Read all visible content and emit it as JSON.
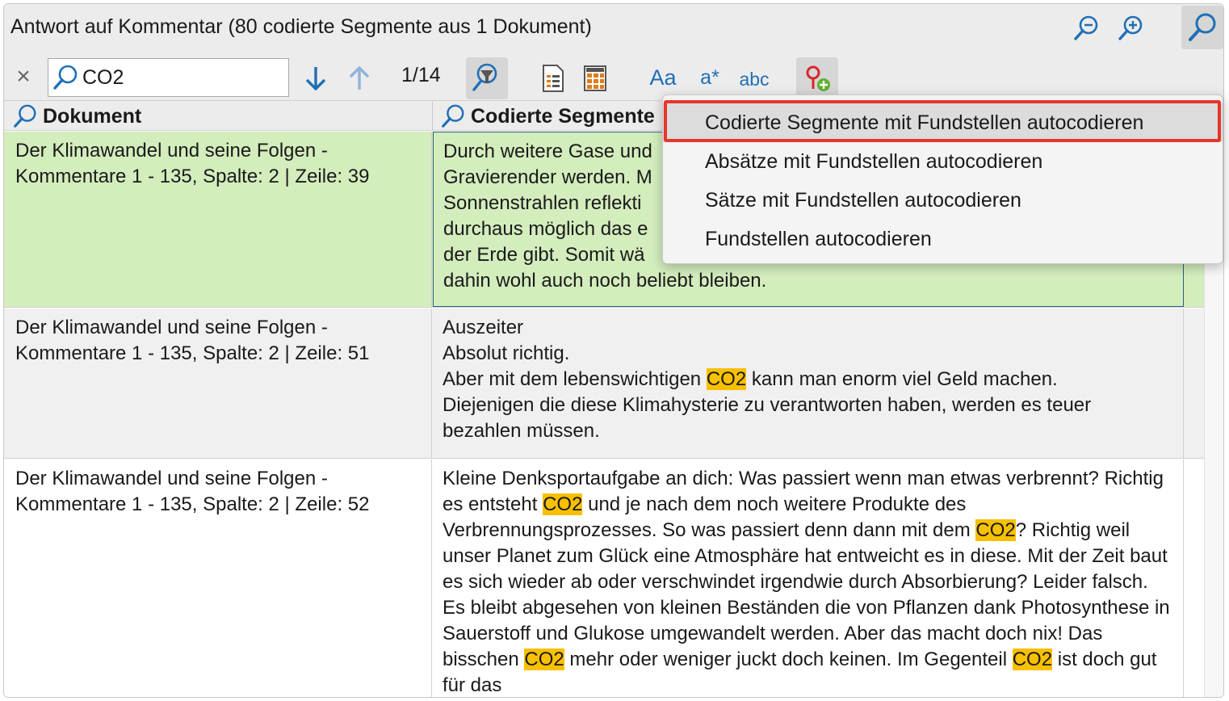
{
  "window": {
    "title": "Antwort auf Kommentar (80 codierte Segmente aus 1 Dokument)"
  },
  "icons": {
    "zoom_out": "zoom-out-icon",
    "zoom_in": "zoom-in-icon",
    "search_toggle": "search-icon",
    "close": "close-icon",
    "next": "arrow-down-icon",
    "previous": "arrow-up-icon",
    "filter": "search-filter-icon",
    "document_view": "document-list-icon",
    "table_view": "table-icon",
    "autocode": "autocode-icon"
  },
  "toolbar": {
    "close_glyph": "×",
    "search_value": "CO2",
    "result_counter": "1/14",
    "case_sensitive_label": "Aa",
    "wildcard_label": "a*",
    "whole_word_label": "abc"
  },
  "table": {
    "columns": [
      "Dokument",
      "Codierte Segmente"
    ],
    "rows": [
      {
        "document": "Der Klimawandel und seine Folgen - Kommentare 1 - 135, Spalte: 2 | Zeile: 39",
        "segment_lines": [
          "Durch weitere Gase und",
          "Gravierender werden. M",
          "Sonnenstrahlen reflekti",
          "durchaus möglich das e",
          "der Erde gibt. Somit wä",
          "dahin wohl auch noch beliebt bleiben."
        ]
      },
      {
        "document": "Der Klimawandel und seine Folgen - Kommentare 1 - 135, Spalte: 2 | Zeile: 51",
        "segment_parts": [
          {
            "t": "Auszeiter\nAbsolut richtig.\nAber mit dem lebenswichtigen "
          },
          {
            "t": "CO2",
            "hl": true
          },
          {
            "t": " kann man enorm viel Geld machen.\nDiejenigen die diese Klimahysterie zu verantworten haben, werden es teuer bezahlen müssen."
          }
        ]
      },
      {
        "document": "Der Klimawandel und seine Folgen - Kommentare 1 - 135, Spalte: 2 | Zeile: 52",
        "segment_parts": [
          {
            "t": "Kleine Denksportaufgabe an dich: Was passiert wenn man etwas verbrennt? Richtig es entsteht "
          },
          {
            "t": "CO2",
            "hl": true
          },
          {
            "t": " und je nach dem noch weitere Produkte des Verbrennungsprozesses. So was passiert denn dann mit dem "
          },
          {
            "t": "CO2",
            "hl": true
          },
          {
            "t": "? Richtig weil unser Planet zum Glück eine Atmosphäre hat entweicht es in diese. Mit der Zeit baut es sich wieder ab oder verschwindet irgendwie durch Absorbierung? Leider falsch. Es bleibt abgesehen von kleinen Beständen die von Pflanzen dank Photosynthese in Sauerstoff und Glukose umgewandelt werden. Aber das macht doch nix! Das bisschen "
          },
          {
            "t": "CO2",
            "hl": true
          },
          {
            "t": " mehr oder weniger juckt doch keinen. Im Gegenteil "
          },
          {
            "t": "CO2",
            "hl": true
          },
          {
            "t": " ist doch gut für das"
          }
        ]
      }
    ]
  },
  "menu": {
    "items": [
      "Codierte Segmente mit Fundstellen autocodieren",
      "Absätze mit Fundstellen autocodieren",
      "Sätze mit Fundstellen autocodieren",
      "Fundstellen autocodieren"
    ]
  },
  "colors": {
    "selected_row": "#d3edbd",
    "alt_row": "#f0f0f0",
    "highlight": "#f8c000",
    "accent": "#1f6fb5",
    "callout": "#e8352b"
  }
}
